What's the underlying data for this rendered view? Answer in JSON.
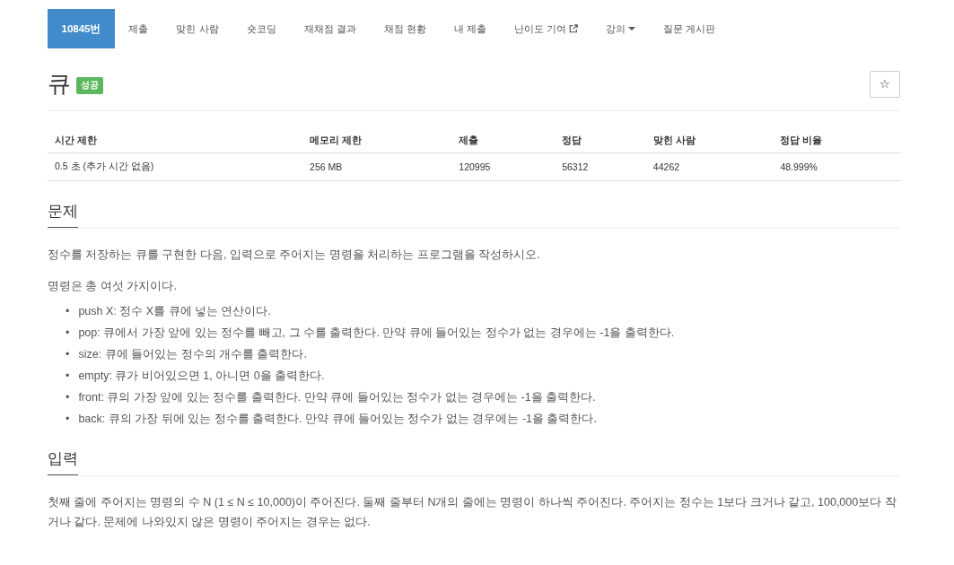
{
  "nav": [
    {
      "label": "10845번",
      "selected": true
    },
    {
      "label": "제출",
      "selected": false
    },
    {
      "label": "맞힌 사람",
      "selected": false
    },
    {
      "label": "숏코딩",
      "selected": false
    },
    {
      "label": "재채점 결과",
      "selected": false
    },
    {
      "label": "채점 현황",
      "selected": false
    },
    {
      "label": "내 제출",
      "selected": false
    },
    {
      "label": "난이도 기여",
      "selected": false,
      "kind": "external"
    },
    {
      "label": "강의",
      "selected": false,
      "kind": "dropdown"
    },
    {
      "label": "질문 게시판",
      "selected": false
    }
  ],
  "title": "큐",
  "badge": "성공",
  "star": "☆",
  "info": {
    "columns": [
      "시간 제한",
      "메모리 제한",
      "제출",
      "정답",
      "맞힌 사람",
      "정답 비율"
    ],
    "row": [
      "0.5 초 (추가 시간 없음)",
      "256 MB",
      "120995",
      "56312",
      "44262",
      "48.999%"
    ]
  },
  "sections": [
    {
      "heading": "문제",
      "paragraphs": [
        "정수를 저장하는 큐를 구현한 다음, 입력으로 주어지는 명령을 처리하는 프로그램을 작성하시오.",
        "명령은 총 여섯 가지이다."
      ],
      "bullet": "•",
      "items": [
        "push X: 정수 X를 큐에 넣는 연산이다.",
        "pop: 큐에서 가장 앞에 있는 정수를 빼고, 그 수를 출력한다. 만약 큐에 들어있는 정수가 없는 경우에는 -1을 출력한다.",
        "size: 큐에 들어있는 정수의 개수를 출력한다.",
        "empty: 큐가 비어있으면 1, 아니면 0을 출력한다.",
        "front: 큐의 가장 앞에 있는 정수를 출력한다. 만약 큐에 들어있는 정수가 없는 경우에는 -1을 출력한다.",
        "back: 큐의 가장 뒤에 있는 정수를 출력한다. 만약 큐에 들어있는 정수가 없는 경우에는 -1을 출력한다."
      ]
    },
    {
      "heading": "입력",
      "paragraphs": [
        "첫째 줄에 주어지는 명령의 수 N (1 ≤ N ≤ 10,000)이 주어진다. 둘째 줄부터 N개의 줄에는 명령이 하나씩 주어진다. 주어지는 정수는 1보다 크거나 같고, 100,000보다 작거나 같다. 문제에 나와있지 않은 명령이 주어지는 경우는 없다."
      ]
    }
  ]
}
